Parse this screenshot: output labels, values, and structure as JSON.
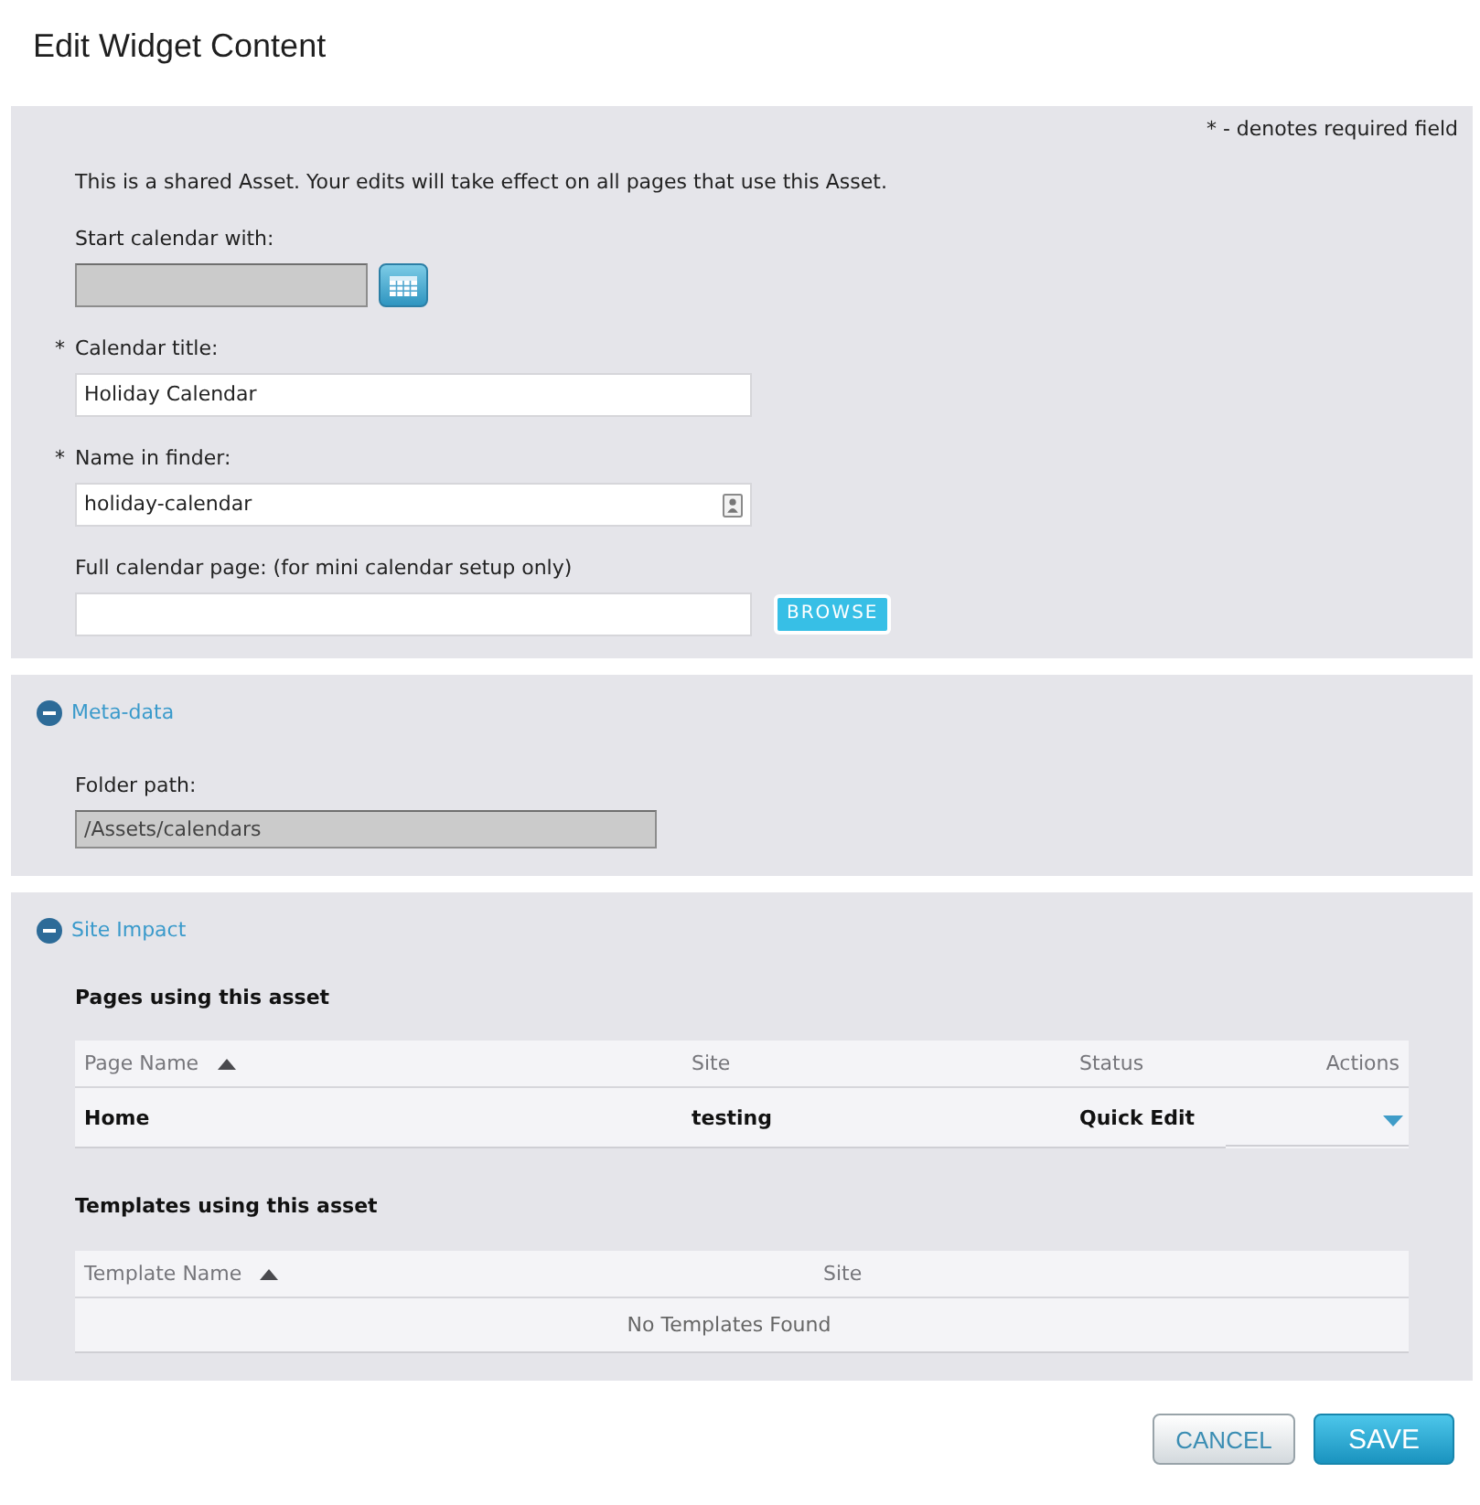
{
  "dialog": {
    "title": "Edit Widget Content"
  },
  "settings_panel": {
    "required_note": "* - denotes required field",
    "notice": "This is a shared Asset. Your edits will take effect on all pages that use this Asset.",
    "fields": [
      {
        "kind": "date",
        "label": "Start calendar with:",
        "disabled": true
      },
      {
        "kind": "text",
        "required_mark": "*",
        "label": "Calendar title:",
        "value": "Holiday Calendar",
        "disabled": false
      },
      {
        "kind": "text_icon",
        "required_mark": "*",
        "label": "Name in finder:",
        "value": "holiday-calendar",
        "disabled": false
      },
      {
        "kind": "browse",
        "label": "Full calendar page: (for mini calendar setup only)",
        "button": "BROWSE",
        "disabled": false
      }
    ]
  },
  "meta_data": {
    "title": "Meta-data",
    "expanded": true,
    "fields": [
      {
        "kind": "path",
        "label": "Folder path:",
        "value": "/Assets/calendars",
        "disabled": true
      }
    ]
  },
  "site_impact": {
    "title": "Site Impact",
    "expanded": true,
    "pages": {
      "heading": "Pages using this asset",
      "columns": [
        {
          "label": "Page Name",
          "sorted": true
        },
        {
          "label": "Site",
          "sorted": false
        },
        {
          "label": "Status",
          "sorted": false
        },
        {
          "label": "Actions",
          "sorted": false
        }
      ],
      "rows": [
        {
          "cells": [
            "Home",
            "testing",
            "Quick Edit"
          ]
        }
      ]
    },
    "templates": {
      "heading": "Templates using this asset",
      "columns": [
        {
          "label": "Template Name",
          "sorted": true
        },
        {
          "label": "Site",
          "sorted": false
        }
      ],
      "empty_message": "No Templates Found"
    }
  },
  "buttons": [
    {
      "kind": "secondary",
      "label": "CANCEL"
    },
    {
      "kind": "primary",
      "label": "SAVE"
    }
  ]
}
